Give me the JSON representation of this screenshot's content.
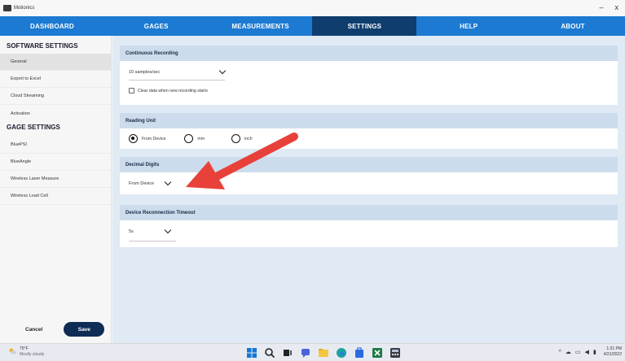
{
  "window": {
    "title": "Motionics",
    "minimize": "–",
    "close": "x"
  },
  "nav": {
    "tabs": [
      {
        "label": "DASHBOARD"
      },
      {
        "label": "GAGES"
      },
      {
        "label": "MEASUREMENTS"
      },
      {
        "label": "SETTINGS",
        "active": true
      },
      {
        "label": "HELP"
      },
      {
        "label": "ABOUT"
      }
    ]
  },
  "sidebar": {
    "software_heading": "SOFTWARE SETTINGS",
    "software_items": [
      "General",
      "Export to Excel",
      "Cloud Streaming",
      "Activation"
    ],
    "gage_heading": "GAGE SETTINGS",
    "gage_items": [
      "BluePSI",
      "BlueAngle",
      "Wireless Laser Measure",
      "Wireless Load Cell"
    ],
    "cancel_label": "Cancel",
    "save_label": "Save"
  },
  "continuous_recording": {
    "header": "Continuous Recording",
    "rate_value": "10 samples/sec",
    "clear_label": "Clear data when new recording starts",
    "clear_checked": false
  },
  "reading_unit": {
    "header": "Reading Unit",
    "options": [
      "From Device",
      "mm",
      "inch"
    ],
    "selected": "From Device"
  },
  "decimal_digits": {
    "header": "Decimal Digits",
    "value": "From Device"
  },
  "reconnection": {
    "header": "Device Reconnection Timeout",
    "value": "5s"
  },
  "colors": {
    "nav_bg": "#1c7ad2",
    "nav_active": "#0f3e6e",
    "save_bg": "#0f2c55",
    "annotation_arrow": "#e8413a"
  },
  "taskbar": {
    "weather_temp": "75°F",
    "weather_desc": "Mostly cloudy",
    "time": "1:31 PM",
    "date": "4/21/2022",
    "tray_icons": [
      "chevron-up-icon",
      "cloud-icon",
      "monitor-icon",
      "speaker-icon",
      "battery-icon"
    ]
  }
}
